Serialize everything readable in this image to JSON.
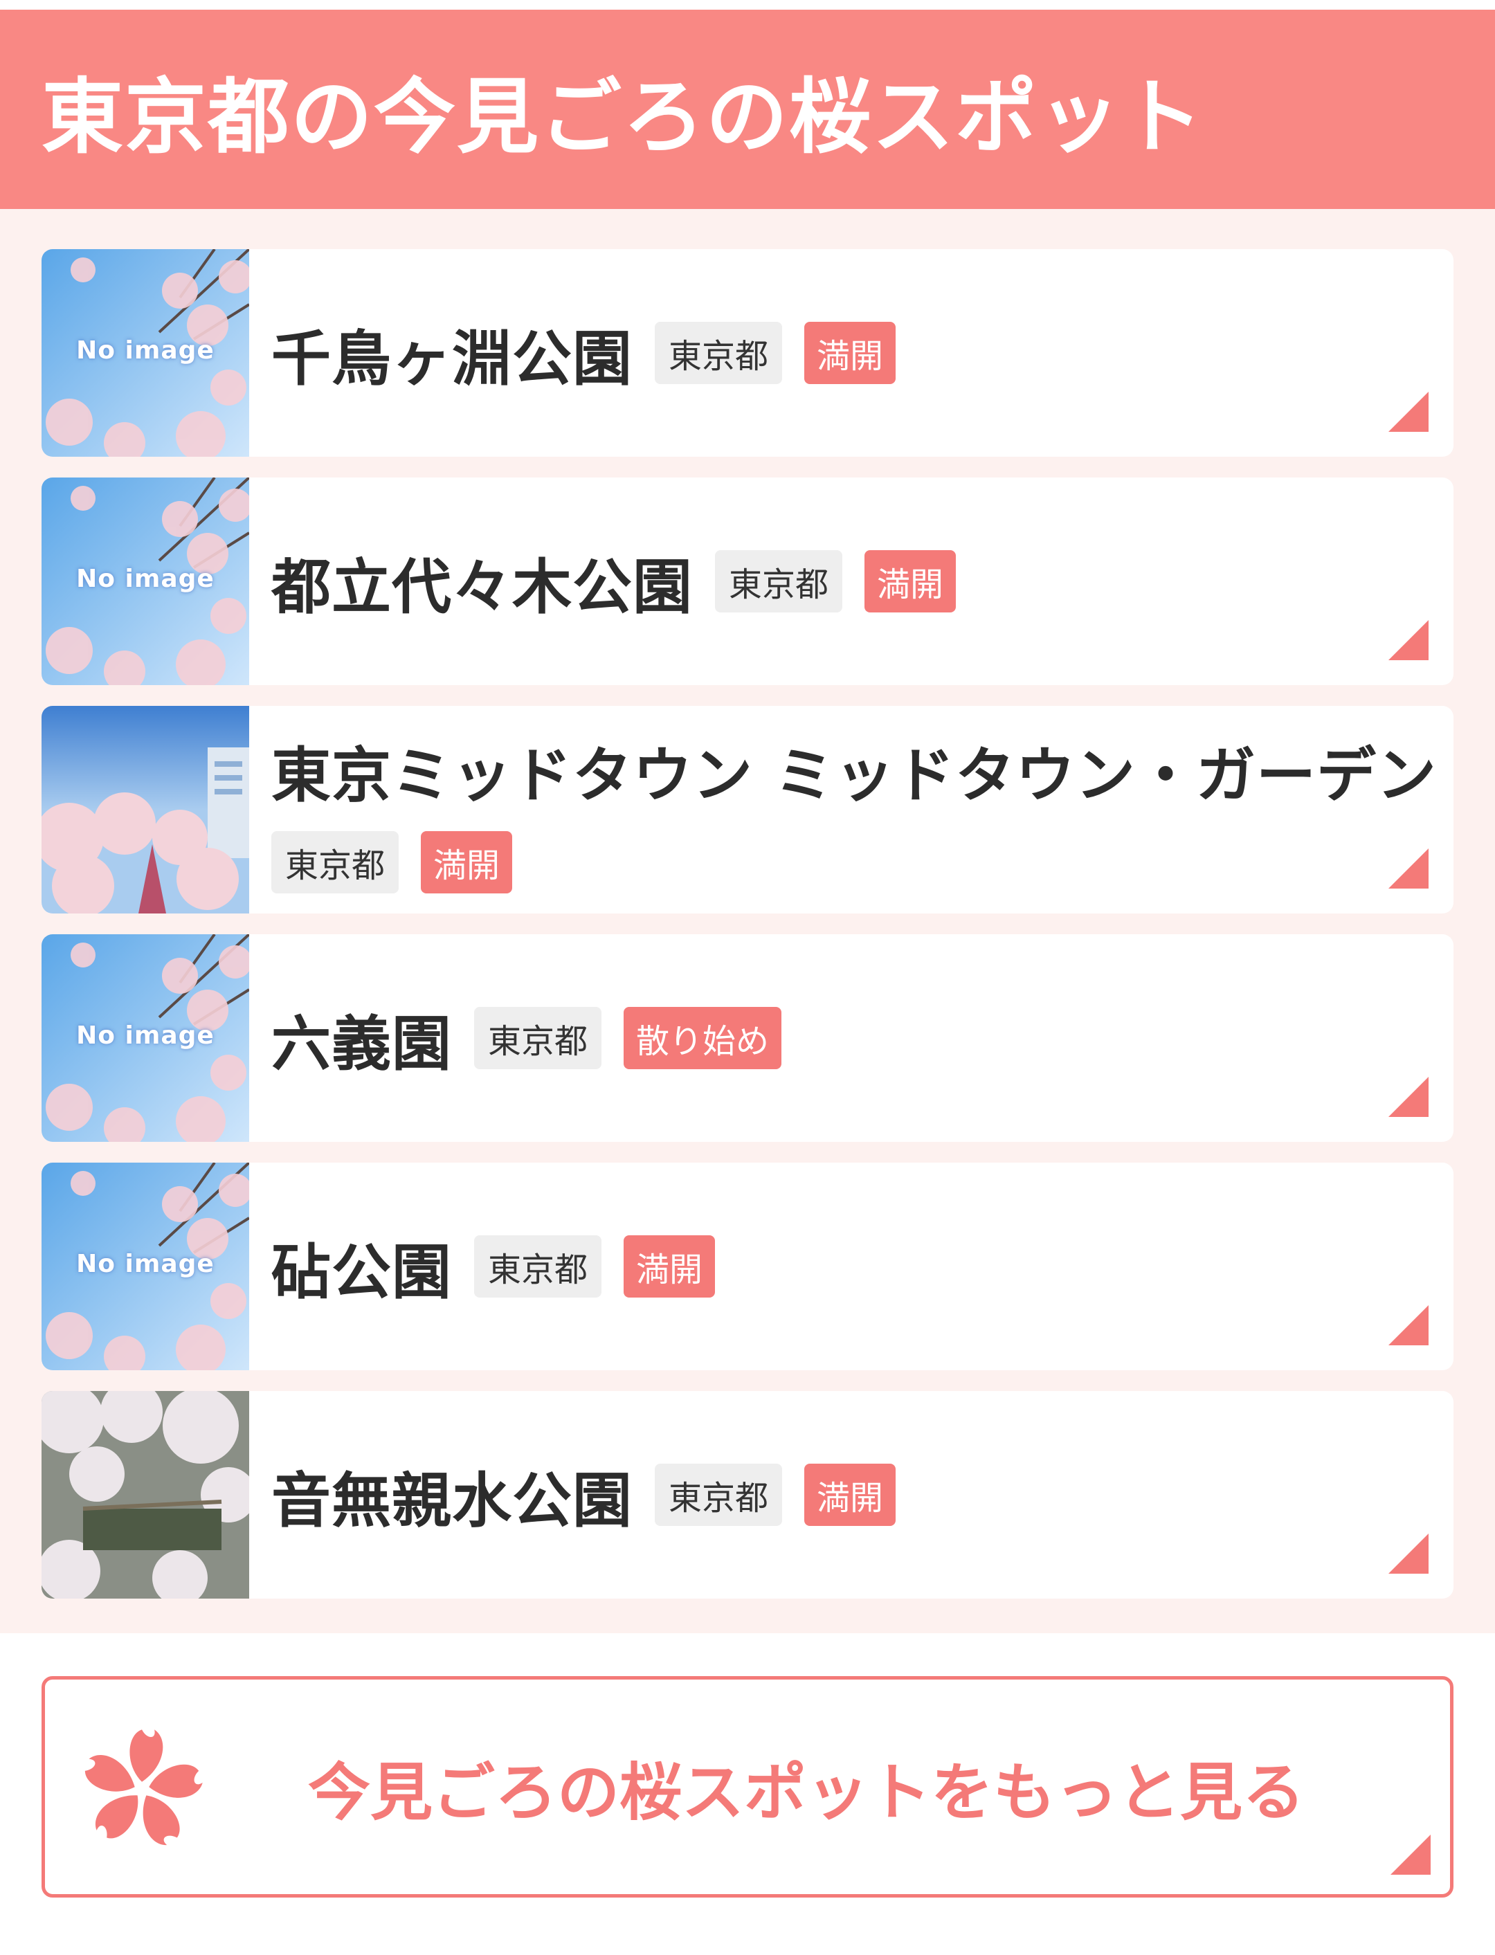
{
  "header": {
    "title": "東京都の今見ごろの桜スポット"
  },
  "spots": [
    {
      "name": "千鳥ヶ淵公園",
      "prefecture": "東京都",
      "status": "満開",
      "image": "no-image",
      "image_label": "No image"
    },
    {
      "name": "都立代々木公園",
      "prefecture": "東京都",
      "status": "満開",
      "image": "no-image",
      "image_label": "No image"
    },
    {
      "name": "東京ミッドタウン ミッドタウン・ガーデン",
      "prefecture": "東京都",
      "status": "満開",
      "image": "photo-midtown"
    },
    {
      "name": "六義園",
      "prefecture": "東京都",
      "status": "散り始め",
      "image": "no-image",
      "image_label": "No image"
    },
    {
      "name": "砧公園",
      "prefecture": "東京都",
      "status": "満開",
      "image": "no-image",
      "image_label": "No image"
    },
    {
      "name": "音無親水公園",
      "prefecture": "東京都",
      "status": "満開",
      "image": "photo-otonashi"
    }
  ],
  "more_button": {
    "label": "今見ごろの桜スポットをもっと見る",
    "icon": "sakura-icon"
  },
  "colors": {
    "accent": "#f47a78",
    "header_bg": "#f98884",
    "list_bg": "#fdf1ef",
    "tag_bg": "#eeeeee"
  }
}
